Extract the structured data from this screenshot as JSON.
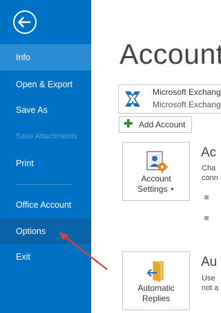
{
  "sidebar": {
    "items": [
      {
        "label": "Info"
      },
      {
        "label": "Open & Export"
      },
      {
        "label": "Save As"
      },
      {
        "label": "Save Attachments"
      },
      {
        "label": "Print"
      },
      {
        "label": "Office Account"
      },
      {
        "label": "Options"
      },
      {
        "label": "Exit"
      }
    ]
  },
  "main": {
    "title": "Account",
    "account": {
      "line1": "Microsoft Exchange",
      "line2": "Microsoft Exchange"
    },
    "add_account_label": "Add Account",
    "account_settings": {
      "label1": "Account",
      "label2": "Settings",
      "heading": "Ac",
      "desc1": "Cha",
      "desc2": "conn"
    },
    "automatic_replies": {
      "label1": "Automatic",
      "label2": "Replies",
      "heading": "Au",
      "desc1": "Use",
      "desc2": "not a"
    }
  },
  "colors": {
    "sidebar_bg": "#0072c6",
    "selected_bg": "#2a8dd4",
    "annotation_arrow": "#d9413b"
  },
  "icons": [
    "back-arrow-icon",
    "exchange-icon",
    "plus-icon",
    "account-settings-icon",
    "automatic-replies-icon"
  ]
}
